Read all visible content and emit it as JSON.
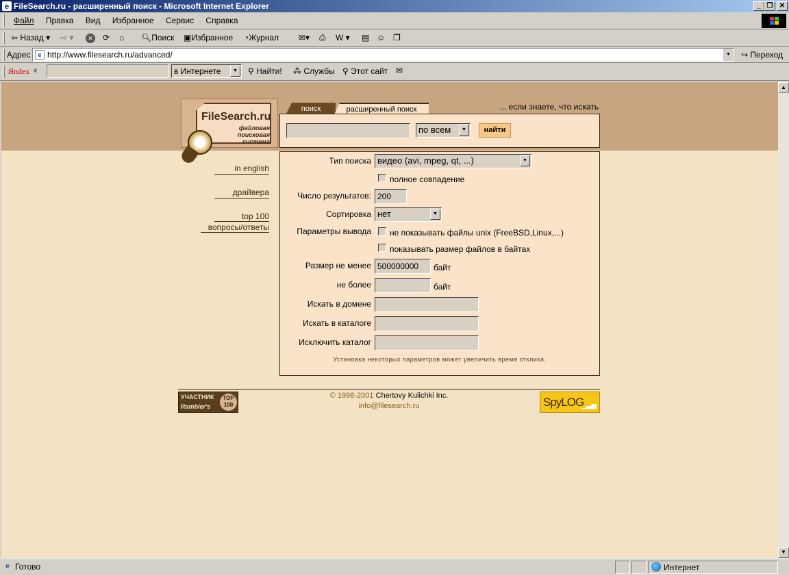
{
  "window": {
    "title": "FileSearch.ru - расширенный поиск - Microsoft Internet Explorer",
    "minimize": "_",
    "restore": "❐",
    "close": "✕"
  },
  "menu": [
    "Файл",
    "Правка",
    "Вид",
    "Избранное",
    "Сервис",
    "Справка"
  ],
  "toolbar": {
    "back": "Назад",
    "search": "Поиск",
    "favorites": "Избранное",
    "history": "Журнал"
  },
  "address": {
    "label": "Адрес",
    "url": "http://www.filesearch.ru/advanced/",
    "go": "Переход"
  },
  "yandex_bar": {
    "logo": "Яndex",
    "scope": "в Интернете",
    "find": "Найти!",
    "services": "Службы",
    "this_site": "Этот сайт"
  },
  "page": {
    "logo": {
      "name": "FileSearch.ru",
      "tag1": "файловая",
      "tag2": "поисковая",
      "tag3": "система"
    },
    "tabs": {
      "simple": "поиск",
      "advanced": "расширенный поиск"
    },
    "hint": "... если знаете, что искать",
    "search": {
      "scope": "по всем",
      "button": "найти"
    },
    "nav": {
      "english": "in english",
      "drivers": "драйвера",
      "top100": "top 100",
      "faq": "вопросы/ответы"
    },
    "form": {
      "type_label": "Тип поиска",
      "type_value": "видео (avi, mpeg, qt, ...)",
      "exact": "полное совпадение",
      "count_label": "Число результатов:",
      "count_value": "200",
      "sort_label": "Сортировка",
      "sort_value": "нет",
      "output_label": "Параметры вывода",
      "no_unix": "не показывать файлы unix (FreeBSD,Linux,...)",
      "bytes": "показывать размер файлов в байтах",
      "min_label": "Размер не менее",
      "min_value": "500000000",
      "unit": "байт",
      "max_label": "не более",
      "max_value": "",
      "domain_label": "Искать в домене",
      "catalog_label": "Искать в каталоге",
      "exclude_label": "Исключить каталог",
      "note": "Установка некоторых параметров может увеличить время отклика."
    },
    "footer": {
      "badge_line1": "УЧАСТНИК",
      "badge_line2": "Rambler's",
      "badge_top": "TOP",
      "badge_100": "100",
      "copyright_year": "© 1998-2001",
      "copyright_name": "Chertovy Kulichki Inc.",
      "email": "info@filesearch.ru",
      "spylog": "SpyLOG"
    }
  },
  "status": {
    "text": "Готово",
    "zone": "Интернет"
  }
}
